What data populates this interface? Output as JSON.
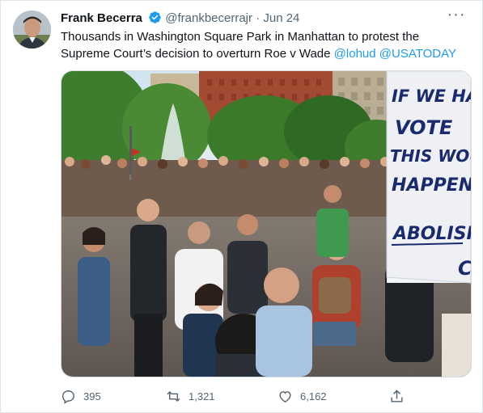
{
  "tweet": {
    "author_name": "Frank Becerra",
    "handle": "@frankbecerrajr",
    "separator": "·",
    "date": "Jun 24",
    "text_line1": "Thousands in Washington Square Park in Manhattan to protest the",
    "text_line2_plain": "Supreme Court’s decision to overturn Roe v Wade ",
    "mention1": "@lohud",
    "mention2": "@USATODAY",
    "more_label": "···"
  },
  "photo": {
    "sign_line1": "IF WE HAD",
    "sign_line2": "VOTE",
    "sign_line3": "THIS WOUL",
    "sign_line4": "HAPPEN",
    "sign_line5": "ABOLISH",
    "sign_line6": "C"
  },
  "actions": {
    "replies": "395",
    "retweets": "1,321",
    "likes": "6,162"
  },
  "colors": {
    "link": "#1d9bf0",
    "secondary": "#536471",
    "verified": "#1d9bf0"
  },
  "icons": {
    "reply": "reply-icon",
    "retweet": "retweet-icon",
    "like": "heart-icon",
    "share": "share-icon",
    "more": "more-icon",
    "verified": "verified-badge-icon"
  }
}
